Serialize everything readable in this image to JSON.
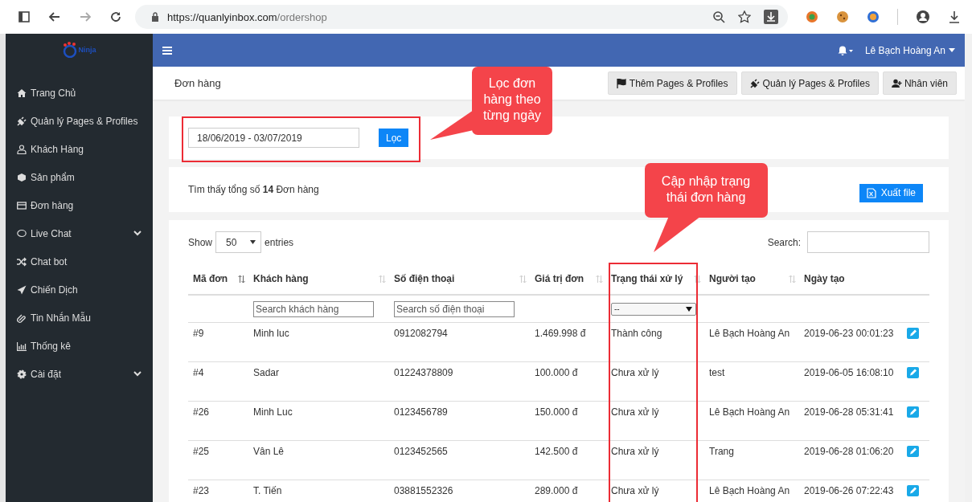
{
  "browser": {
    "url_host": "https://quanlyinbox.com",
    "url_path": "/ordershop"
  },
  "logo": {
    "text": "Ninja"
  },
  "topbar": {
    "user": "Lê Bạch Hoàng An"
  },
  "sidebar": {
    "items": [
      {
        "label": "Trang Chủ",
        "kind": "home",
        "has_submenu": false
      },
      {
        "label": "Quản lý Pages & Profiles",
        "kind": "plug",
        "has_submenu": false
      },
      {
        "label": "Khách Hàng",
        "kind": "user",
        "has_submenu": false
      },
      {
        "label": "Sản phẩm",
        "kind": "cube",
        "has_submenu": false
      },
      {
        "label": "Đơn hàng",
        "kind": "card",
        "has_submenu": false
      },
      {
        "label": "Live Chat",
        "kind": "chat",
        "has_submenu": true
      },
      {
        "label": "Chat bot",
        "kind": "shuffle",
        "has_submenu": false
      },
      {
        "label": "Chiến Dịch",
        "kind": "send",
        "has_submenu": false
      },
      {
        "label": "Tin Nhắn Mẫu",
        "kind": "clip",
        "has_submenu": false
      },
      {
        "label": "Thống kê",
        "kind": "chart",
        "has_submenu": false
      },
      {
        "label": "Cài đặt",
        "kind": "gear",
        "has_submenu": true
      }
    ]
  },
  "header": {
    "title": "Đơn hàng",
    "buttons": [
      {
        "label": "Thêm Pages & Profiles",
        "kind": "flag"
      },
      {
        "label": "Quản lý Pages & Profiles",
        "kind": "plug"
      },
      {
        "label": "Nhân viên",
        "kind": "adduser"
      }
    ]
  },
  "filter": {
    "date_range": "18/06/2019 - 03/07/2019",
    "button": "Lọc"
  },
  "summary": {
    "text": "Tìm thấy tổng số **14** Đơn hàng",
    "export_button": "Xuất file"
  },
  "table": {
    "show_label": "Show",
    "page_length": "50",
    "entries_label": "entries",
    "search_label": "Search:",
    "columns": [
      {
        "label": "Mã đơn",
        "sortable": true
      },
      {
        "label": "Khách hàng",
        "sortable": true,
        "placeholder": "Search khách hàng"
      },
      {
        "label": "Số điện thoại",
        "sortable": true,
        "placeholder": "Search số điện thoại"
      },
      {
        "label": "Giá trị đơn",
        "sortable": true
      },
      {
        "label": "Trạng thái xử lý",
        "sortable": true,
        "value": "--"
      },
      {
        "label": "Người tạo",
        "sortable": true
      },
      {
        "label": "Ngày tạo",
        "sortable": false
      }
    ],
    "rows": [
      {
        "cells": [
          "#9",
          "Minh luc",
          "0912082794",
          "1.469.998 đ",
          "Thành công",
          "Lê Bạch Hoàng An",
          "2019-06-23 00:01:23"
        ]
      },
      {
        "cells": [
          "#4",
          "Sadar",
          "01224378809",
          "100.000 đ",
          "Chưa xử lý",
          "test",
          "2019-06-05 16:08:10"
        ]
      },
      {
        "cells": [
          "#26",
          "Minh Luc",
          "0123456789",
          "150.000 đ",
          "Chưa xử lý",
          "Lê Bạch Hoàng An",
          "2019-06-28 05:31:41"
        ]
      },
      {
        "cells": [
          "#25",
          "Vân Lê",
          "0123452565",
          "142.500 đ",
          "Chưa xử lý",
          "Trang",
          "2019-06-28 01:06:20"
        ]
      },
      {
        "cells": [
          "#23",
          "T. Tiến",
          "03881552326",
          "289.000 đ",
          "Chưa xử lý",
          "Lê Bạch Hoàng An",
          "2019-06-26 07:22:43"
        ]
      }
    ]
  },
  "callouts": [
    {
      "text": "Lọc đơn hàng theo từng ngày"
    },
    {
      "text": "Cập nhập trạng thái đơn hàng"
    }
  ]
}
